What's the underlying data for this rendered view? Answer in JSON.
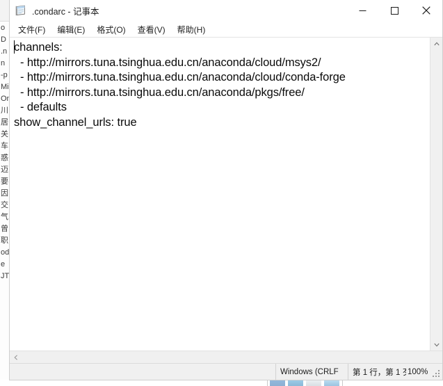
{
  "window": {
    "title": ".condarc - 记事本",
    "app_icon": "notepad-icon",
    "controls": {
      "minimize": "—",
      "maximize": "□",
      "close": "✕"
    }
  },
  "menubar": {
    "items": [
      {
        "label": "文件(F)",
        "name": "menu-file"
      },
      {
        "label": "编辑(E)",
        "name": "menu-edit"
      },
      {
        "label": "格式(O)",
        "name": "menu-format"
      },
      {
        "label": "查看(V)",
        "name": "menu-view"
      },
      {
        "label": "帮助(H)",
        "name": "menu-help"
      }
    ]
  },
  "document": {
    "lines": [
      "channels:",
      "  - http://mirrors.tuna.tsinghua.edu.cn/anaconda/cloud/msys2/",
      "  - http://mirrors.tuna.tsinghua.edu.cn/anaconda/cloud/conda-forge",
      "  - http://mirrors.tuna.tsinghua.edu.cn/anaconda/pkgs/free/",
      "  - defaults",
      "show_channel_urls: true"
    ]
  },
  "scrollbars": {
    "vertical": {
      "up_arrow": "⌃",
      "down_arrow": "⌄"
    },
    "horizontal": {
      "left_arrow": "‹"
    }
  },
  "statusbar": {
    "encoding": "Windows (CRLF",
    "position": "第 1 行，第 1 歹",
    "zoom": "100%"
  },
  "background": {
    "left_window_lines": [
      "o",
      "D",
      ".n",
      "n",
      "-p",
      "Mi",
      "On",
      "川",
      "居",
      "关",
      "车",
      "惑",
      "迈",
      "要",
      "因",
      "交",
      "气",
      "曾",
      "职",
      "od",
      "e",
      "JT"
    ]
  }
}
